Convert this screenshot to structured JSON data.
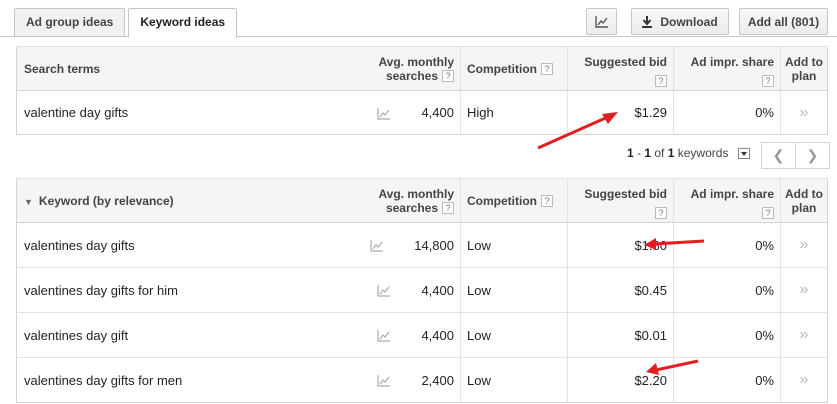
{
  "tabs": [
    "Ad group ideas",
    "Keyword ideas"
  ],
  "toolbar": {
    "download": "Download",
    "add_all": "Add all (801)"
  },
  "columns": {
    "search_terms": "Search terms",
    "keyword": "Keyword (by relevance)",
    "avg1": "Avg. monthly",
    "avg2": "searches",
    "competition": "Competition",
    "bid": "Suggested bid",
    "share": "Ad impr. share",
    "add": "Add to plan"
  },
  "search_row": {
    "term": "valentine day gifts",
    "searches": "4,400",
    "competition": "High",
    "bid": "$1.29",
    "share": "0%"
  },
  "pager": {
    "a": "1",
    "sep": " - ",
    "b": "1",
    "of": " of ",
    "c": "1",
    "label": " keywords"
  },
  "rows": [
    {
      "term": "valentines day gifts",
      "searches": "14,800",
      "competition": "Low",
      "bid": "$1.80",
      "share": "0%"
    },
    {
      "term": "valentines day gifts for him",
      "searches": "4,400",
      "competition": "Low",
      "bid": "$0.45",
      "share": "0%"
    },
    {
      "term": "valentines day gift",
      "searches": "4,400",
      "competition": "Low",
      "bid": "$0.01",
      "share": "0%"
    },
    {
      "term": "valentines day gifts for men",
      "searches": "2,400",
      "competition": "Low",
      "bid": "$2.20",
      "share": "0%"
    }
  ],
  "help_glyph": "?",
  "add_glyph": "»",
  "colors": {
    "annotation": "#e02020"
  }
}
